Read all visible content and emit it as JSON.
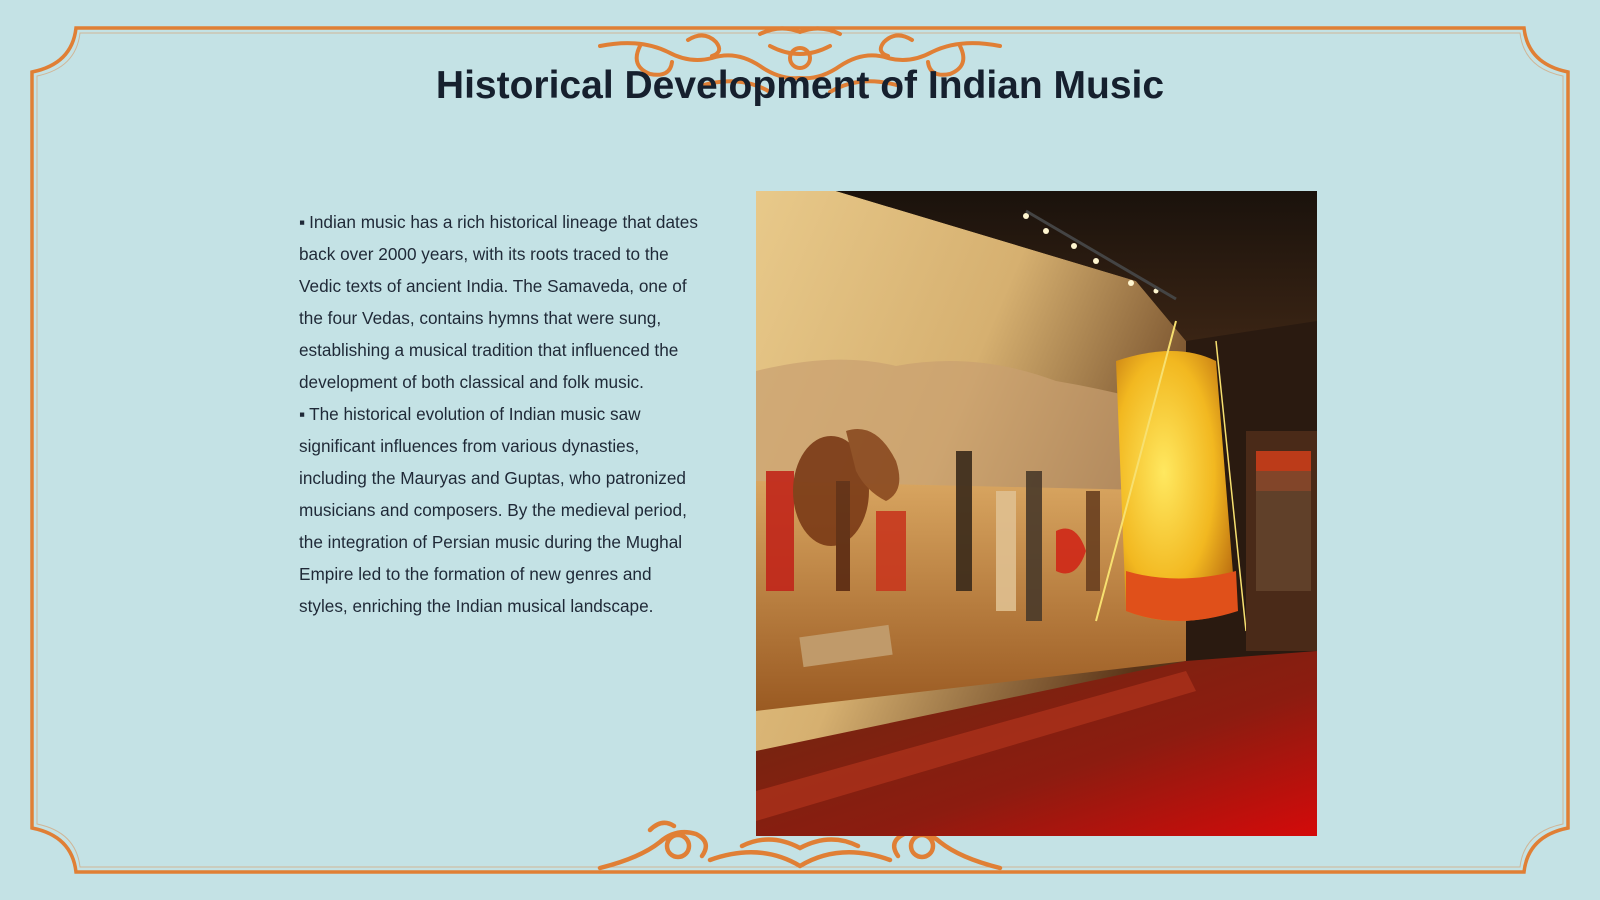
{
  "slide": {
    "title": "Historical Development of Indian Music",
    "bullets": [
      {
        "marker": "▪",
        "text": "Indian music has a rich historical lineage that dates back over 2000 years, with its roots traced to the Vedic texts of ancient India. The Samaveda, one of the four Vedas, contains hymns that were sung, establishing a musical tradition that influenced the development of both classical and folk music."
      },
      {
        "marker": "▪",
        "text": "The historical evolution of Indian music saw significant influences from various dynasties, including the Mauryas and Guptas, who patronized musicians and composers. By the medieval period, the integration of Persian music during the Mughal Empire led to the formation of new genres and styles, enriching the Indian musical landscape."
      }
    ]
  },
  "colors": {
    "background": "#c4e2e5",
    "frame": "#e07f35",
    "title": "#16202e",
    "text": "#1f2937"
  },
  "icons": {
    "ornament_top": "scroll-flourish-ornament",
    "ornament_bottom": "scroll-flourish-ornament"
  }
}
